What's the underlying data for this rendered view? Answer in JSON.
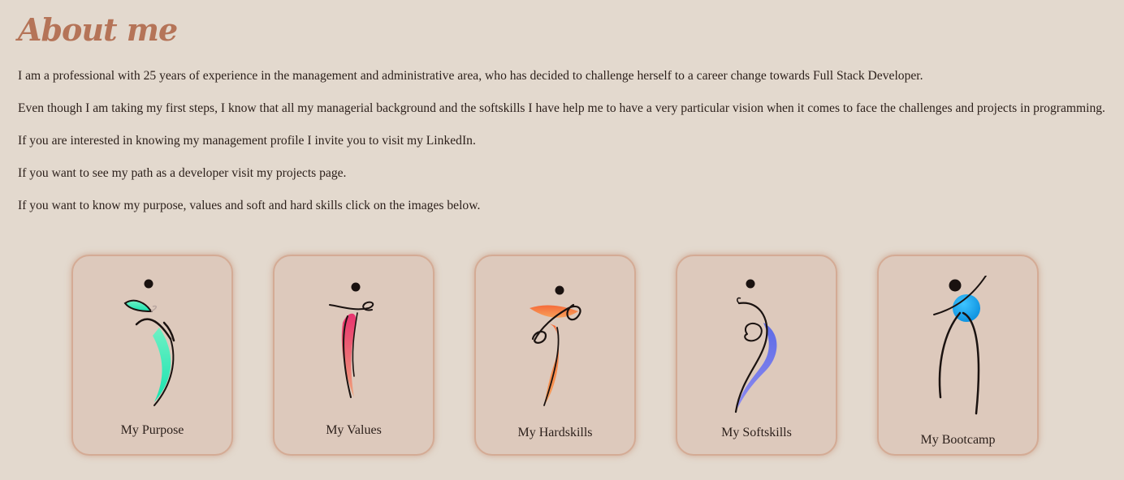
{
  "page": {
    "title": "About me",
    "paragraphs": [
      "I am a professional with 25 years of experience in the management and administrative area, who has decided to challenge herself to a career change towards Full Stack Developer.",
      "Even though I am taking my first steps, I know that all my managerial background and the softskills I have help me to have a very particular vision when it comes to face the challenges and projects in programming.",
      "If you are interested in knowing my management profile I invite you to visit my LinkedIn.",
      "If you want to see my path as a developer visit my projects page.",
      "If you want to know my purpose, values and soft and hard skills click on the images below."
    ]
  },
  "cards": [
    {
      "label": "My Purpose",
      "accent": "#3ee8b0",
      "icon": "dancer-green-icon"
    },
    {
      "label": "My Values",
      "accent": "#ef3f6e",
      "icon": "dancer-pink-icon"
    },
    {
      "label": "My Hardskills",
      "accent": "#f2833a",
      "icon": "dancer-orange-icon"
    },
    {
      "label": "My Softskills",
      "accent": "#6b78e6",
      "icon": "dancer-blue-icon"
    },
    {
      "label": "My Bootcamp",
      "accent": "#1aa6ec",
      "icon": "dancer-cyan-icon"
    }
  ],
  "colors": {
    "background": "#e3d9ce",
    "card": "#ddc9bc",
    "card_border": "#d4ab95",
    "title": "#b57458",
    "text": "#2b1f1a"
  }
}
